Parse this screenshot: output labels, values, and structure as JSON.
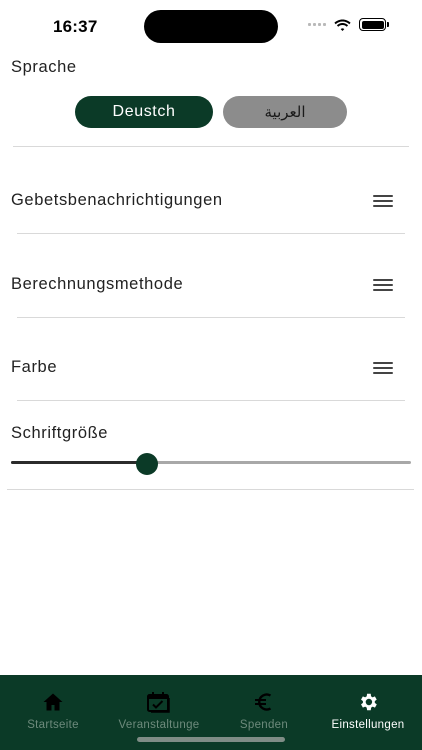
{
  "status_bar": {
    "time": "16:37"
  },
  "language": {
    "label": "Sprache",
    "options": [
      "Deustch",
      "العربية"
    ],
    "selected": "Deustch"
  },
  "settings_rows": [
    {
      "label": "Gebetsbenachrichtigungen",
      "icon": "menu-icon"
    },
    {
      "label": "Berechnungsmethode",
      "icon": "menu-icon"
    },
    {
      "label": "Farbe",
      "icon": "menu-icon"
    }
  ],
  "font_size": {
    "label": "Schriftgröße",
    "value_fraction": 0.34
  },
  "tabbar": {
    "items": [
      {
        "label": "Startseite",
        "icon": "home-icon",
        "active": false
      },
      {
        "label": "Veranstaltunge",
        "icon": "calendar-check-icon",
        "active": false
      },
      {
        "label": "Spenden",
        "icon": "euro-icon",
        "active": false
      },
      {
        "label": "Einstellungen",
        "icon": "gear-icon",
        "active": true
      }
    ]
  },
  "colors": {
    "accent": "#0b3a27",
    "inactive_button": "#8c8c8c",
    "tab_inactive_text": "#6d8a7c"
  }
}
